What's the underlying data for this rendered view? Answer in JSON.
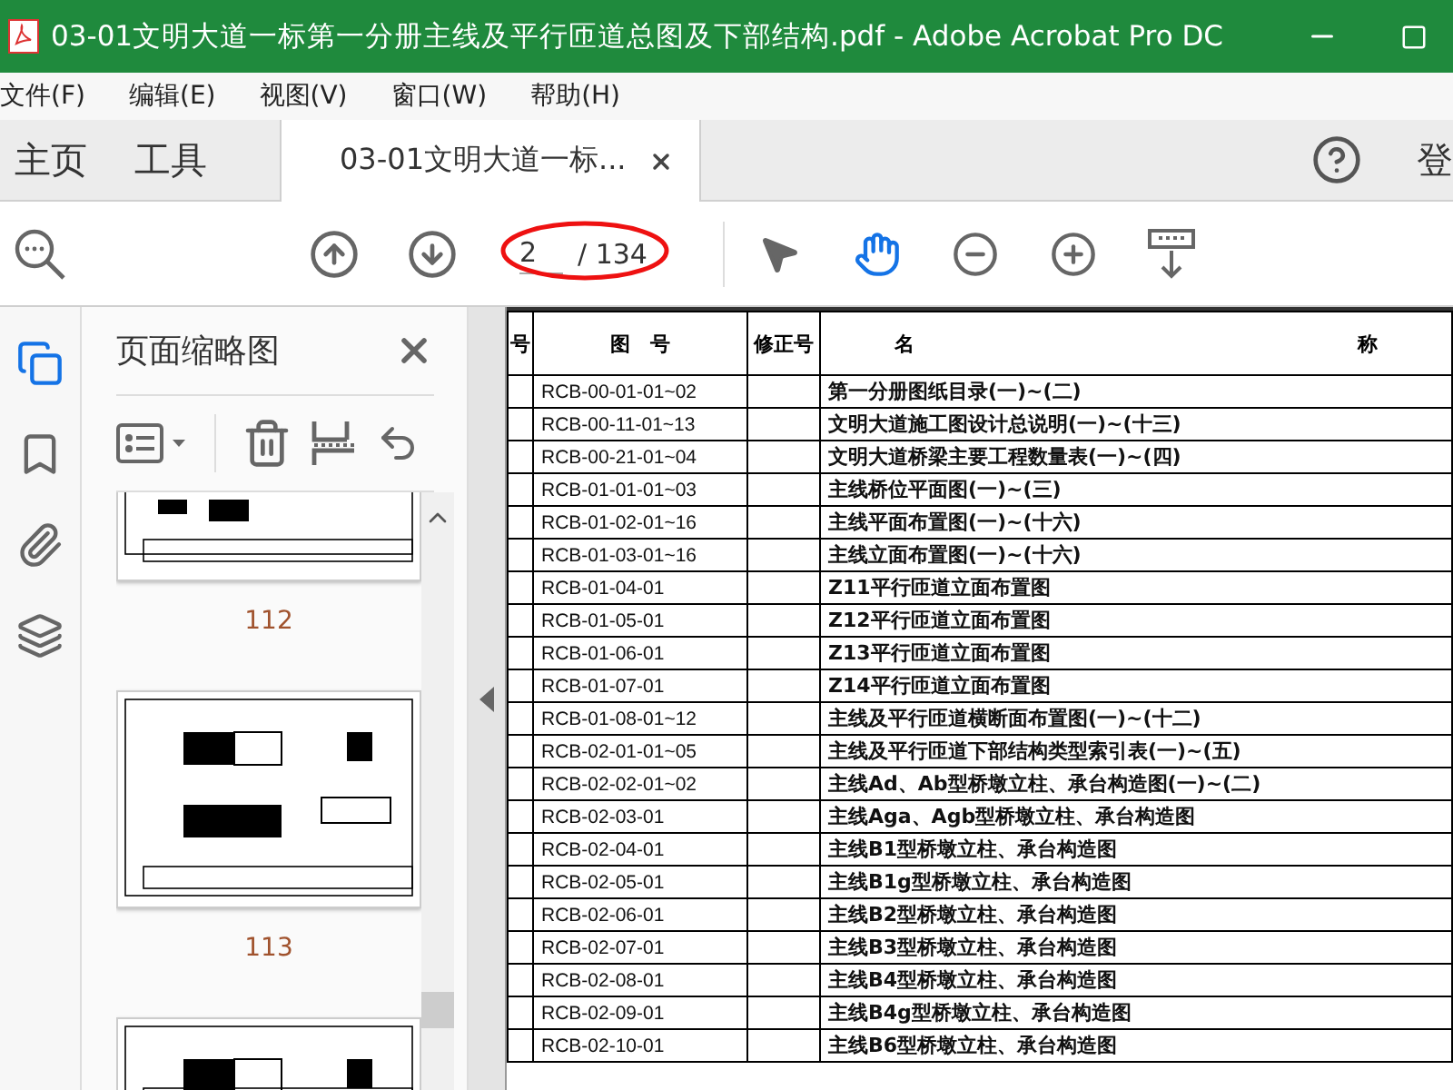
{
  "window": {
    "title": "03-01文明大道一标第一分册主线及平行匝道总图及下部结构.pdf - Adobe Acrobat Pro DC"
  },
  "menu": [
    "文件(F)",
    "编辑(E)",
    "视图(V)",
    "窗口(W)",
    "帮助(H)"
  ],
  "tabs": [
    {
      "label": "主页",
      "selected": false,
      "closable": false
    },
    {
      "label": "工具",
      "selected": false,
      "closable": false
    },
    {
      "label": "03-01文明大道一标...",
      "selected": true,
      "closable": true
    }
  ],
  "account_label": "登",
  "toolbar": {
    "page": {
      "current": "2",
      "total": "/ 134",
      "highlighted": true
    },
    "tools": [
      {
        "kind": "select",
        "selected": false
      },
      {
        "kind": "hand",
        "selected": true
      },
      {
        "kind": "zoom-out",
        "selected": false
      },
      {
        "kind": "zoom-in",
        "selected": false
      },
      {
        "kind": "fit",
        "selected": false
      }
    ]
  },
  "sidebar": {
    "items": [
      {
        "kind": "pages",
        "selected": true
      },
      {
        "kind": "bookmarks",
        "selected": false
      },
      {
        "kind": "attachments",
        "selected": false
      },
      {
        "kind": "layers",
        "selected": false
      }
    ]
  },
  "thumbnails": {
    "title": "页面缩略图",
    "pages": [
      {
        "label": "112",
        "kind": "partial"
      },
      {
        "label": "113",
        "kind": "full"
      }
    ]
  },
  "table": {
    "columns": [
      "号",
      "图　号",
      "修正号",
      "名 称"
    ],
    "rows": [
      {
        "drawing_no": "RCB-00-01-01~02",
        "name": "第一分册图纸目录(一)~(二)"
      },
      {
        "drawing_no": "RCB-00-11-01~13",
        "name": "文明大道施工图设计总说明(一)~(十三)"
      },
      {
        "drawing_no": "RCB-00-21-01~04",
        "name": "文明大道桥梁主要工程数量表(一)~(四)"
      },
      {
        "drawing_no": "RCB-01-01-01~03",
        "name": "主线桥位平面图(一)~(三)"
      },
      {
        "drawing_no": "RCB-01-02-01~16",
        "name": "主线平面布置图(一)~(十六)"
      },
      {
        "drawing_no": "RCB-01-03-01~16",
        "name": "主线立面布置图(一)~(十六)"
      },
      {
        "drawing_no": "RCB-01-04-01",
        "name": "Z11平行匝道立面布置图"
      },
      {
        "drawing_no": "RCB-01-05-01",
        "name": "Z12平行匝道立面布置图"
      },
      {
        "drawing_no": "RCB-01-06-01",
        "name": "Z13平行匝道立面布置图"
      },
      {
        "drawing_no": "RCB-01-07-01",
        "name": "Z14平行匝道立面布置图"
      },
      {
        "drawing_no": "RCB-01-08-01~12",
        "name": "主线及平行匝道横断面布置图(一)~(十二)"
      },
      {
        "drawing_no": "RCB-02-01-01~05",
        "name": "主线及平行匝道下部结构类型索引表(一)~(五)"
      },
      {
        "drawing_no": "RCB-02-02-01~02",
        "name": "主线Ad、Ab型桥墩立柱、承台构造图(一)~(二)"
      },
      {
        "drawing_no": "RCB-02-03-01",
        "name": "主线Aga、Agb型桥墩立柱、承台构造图"
      },
      {
        "drawing_no": "RCB-02-04-01",
        "name": "主线B1型桥墩立柱、承台构造图"
      },
      {
        "drawing_no": "RCB-02-05-01",
        "name": "主线B1g型桥墩立柱、承台构造图"
      },
      {
        "drawing_no": "RCB-02-06-01",
        "name": "主线B2型桥墩立柱、承台构造图"
      },
      {
        "drawing_no": "RCB-02-07-01",
        "name": "主线B3型桥墩立柱、承台构造图"
      },
      {
        "drawing_no": "RCB-02-08-01",
        "name": "主线B4型桥墩立柱、承台构造图"
      },
      {
        "drawing_no": "RCB-02-09-01",
        "name": "主线B4g型桥墩立柱、承台构造图"
      },
      {
        "drawing_no": "RCB-02-10-01",
        "name": "主线B6型桥墩立柱、承台构造图"
      }
    ]
  }
}
